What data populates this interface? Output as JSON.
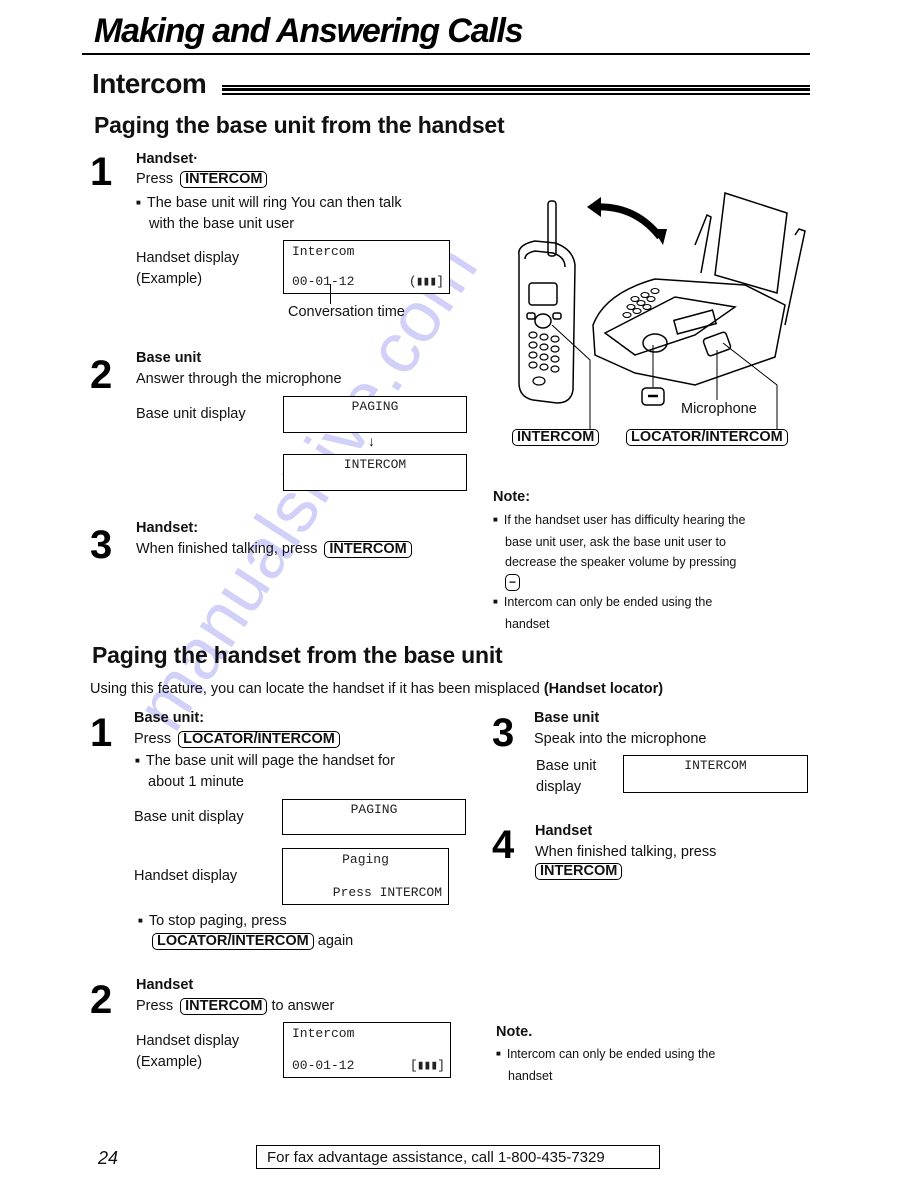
{
  "header": {
    "title": "Making and Answering Calls"
  },
  "section": {
    "title": "Intercom"
  },
  "part1": {
    "title": "Paging the base unit from the handset",
    "steps": [
      {
        "number": "1",
        "heading": "Handset·",
        "action_prefix": "Press",
        "action_key": "INTERCOM",
        "bullet_line1": "The base unit will ring  You can then talk",
        "bullet_line2": "with the base unit user",
        "display_label_line1": "Handset display",
        "display_label_line2": "(Example)",
        "display": {
          "line1": "Intercom",
          "line2": "00-01-12",
          "signal": "(▮▮▮]"
        },
        "callout": "Conversation time"
      },
      {
        "number": "2",
        "heading": "Base unit",
        "text": "Answer through the microphone",
        "display_label": "Base unit display",
        "display_before": "PAGING",
        "arrow": "↓",
        "display_after": "INTERCOM"
      },
      {
        "number": "3",
        "heading": "Handset:",
        "text": "When finished talking, press",
        "action_key": "INTERCOM"
      }
    ],
    "illustration": {
      "handset_key": "INTERCOM",
      "base_key": "LOCATOR/INTERCOM",
      "volume_key": "−",
      "microphone_label": "Microphone"
    },
    "note": {
      "heading": "Note:",
      "bullets": [
        [
          "If the handset user has difficulty hearing the",
          "base unit user, ask the base unit user to",
          "decrease the speaker volume by pressing"
        ],
        [
          "Intercom can only be ended using the",
          "handset"
        ]
      ],
      "volume_key": "−"
    }
  },
  "part2": {
    "title": "Paging the handset from the base unit",
    "intro": "Using this feature, you can locate the handset if it has been misplaced",
    "intro_bold": "(Handset locator)",
    "steps": [
      {
        "number": "1",
        "heading": "Base unit:",
        "action_prefix": "Press",
        "action_key": "LOCATOR/INTERCOM",
        "bullet_line1": "The base unit will page the handset for",
        "bullet_line2": "about 1 minute",
        "base_display_label": "Base unit display",
        "base_display": "PAGING",
        "handset_display_label": "Handset display",
        "handset_display": {
          "line1": "Paging",
          "line2": "Press INTERCOM"
        },
        "stop_bullet": "To stop paging, press",
        "stop_key": "LOCATOR/INTERCOM",
        "stop_suffix": "again"
      },
      {
        "number": "2",
        "heading": "Handset",
        "action_prefix": "Press",
        "action_key": "INTERCOM",
        "action_suffix": "to answer",
        "display_label_line1": "Handset display",
        "display_label_line2": "(Example)",
        "display": {
          "line1": "Intercom",
          "line2": "00-01-12",
          "signal": "[▮▮▮]"
        }
      },
      {
        "number": "3",
        "heading": "Base unit",
        "text": "Speak into the microphone",
        "display_label_line1": "Base unit",
        "display_label_line2": "display",
        "display": "INTERCOM"
      },
      {
        "number": "4",
        "heading": "Handset",
        "text": "When finished talking, press",
        "action_key": "INTERCOM"
      }
    ],
    "note": {
      "heading": "Note.",
      "bullet_line1": "Intercom can only be ended using the",
      "bullet_line2": "handset"
    }
  },
  "footer": {
    "page_number": "24",
    "assistance": "For fax advantage assistance, call 1-800-435-7329"
  },
  "watermark": {
    "text": "manualshive.com",
    "color": "#c8c8f8"
  }
}
